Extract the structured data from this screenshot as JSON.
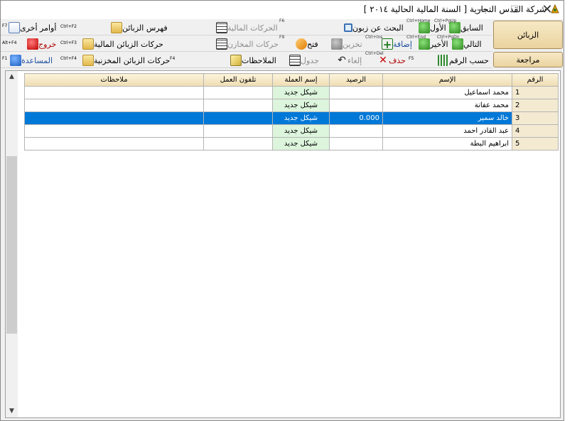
{
  "window": {
    "title": "شركة القدس التجارية  [ السنة المالية الحالية ٢٠١٤ ]",
    "min_label": "—",
    "max_label": "☐",
    "close_label": "✕"
  },
  "toolbar": {
    "row1": [
      {
        "label": "السابق",
        "shortcut": "Ctrl+PgUp",
        "icon": "arrow-up-green-icon"
      },
      {
        "label": "الأول",
        "shortcut": "Ctrl+Home",
        "icon": "double-up-green-icon"
      },
      {
        "label": "البحث عن زبون",
        "shortcut": "",
        "icon": "search-icon"
      },
      {
        "label": "الحركات المالية",
        "shortcut": "F6",
        "icon": "grid-icon"
      },
      {
        "label": "فهرس الزبائن",
        "shortcut": "Ctrl+F2",
        "icon": "folder-icon"
      },
      {
        "label": "أوامر أخرى",
        "shortcut": "F7",
        "icon": "commands-icon"
      }
    ],
    "row2": [
      {
        "label": "التالي",
        "shortcut": "Ctrl+PgDn",
        "icon": "arrow-down-green-icon"
      },
      {
        "label": "الأخير",
        "shortcut": "Ctrl+End",
        "icon": "double-down-green-icon"
      },
      {
        "label": "إضافة",
        "shortcut": "Ctrl+Ins",
        "icon": "add-icon"
      },
      {
        "label": "تخزين",
        "shortcut": "",
        "icon": "save-icon"
      },
      {
        "label": "فتح",
        "shortcut": "",
        "icon": "open-icon"
      },
      {
        "label": "حركات المخازن",
        "shortcut": "F9",
        "icon": "grid-icon"
      },
      {
        "label": "حركات الزبائن المالية",
        "shortcut": "Ctrl+F3",
        "icon": "folder-icon"
      },
      {
        "label": "خروج",
        "shortcut": "Alt+F4",
        "icon": "exit-icon"
      }
    ],
    "row3": [
      {
        "label": "حسب الرقم",
        "shortcut": "F5",
        "icon": "sort-icon"
      },
      {
        "label": "حذف",
        "shortcut": "Ctrl+Del",
        "icon": "delete-icon"
      },
      {
        "label": "إلغاء",
        "shortcut": "",
        "icon": "undo-icon"
      },
      {
        "label": "جدول",
        "shortcut": "",
        "icon": "table-icon"
      },
      {
        "label": "الملاحظات",
        "shortcut": "",
        "icon": "notes-icon"
      },
      {
        "label": "حركات الزبائن المخزنية",
        "shortcut": "F4",
        "icon": "folder-icon"
      },
      {
        "label": "المساعدة",
        "shortcut": "Ctrl+F4",
        "icon": "help-icon"
      },
      {
        "label": "",
        "shortcut": "F1",
        "icon": ""
      }
    ]
  },
  "side": {
    "customers_label": "الزبائن",
    "review_label": "مراجعة"
  },
  "grid": {
    "columns": [
      "الرقم",
      "الإسم",
      "الرصيد",
      "إسم العملة",
      "تلفون العمل",
      "ملاحظات"
    ],
    "rows": [
      {
        "num": "1",
        "name": "محمد اسماعيل",
        "balance": "",
        "currency": "شيكل جديد",
        "phone": "",
        "notes": ""
      },
      {
        "num": "2",
        "name": "محمد عفانة",
        "balance": "",
        "currency": "شيكل جديد",
        "phone": "",
        "notes": ""
      },
      {
        "num": "3",
        "name": "خالد سمير",
        "balance": "0.000",
        "currency": "شيكل جديد",
        "phone": "",
        "notes": ""
      },
      {
        "num": "4",
        "name": "عبد القادر احمد",
        "balance": "",
        "currency": "شيكل جديد",
        "phone": "",
        "notes": ""
      },
      {
        "num": "5",
        "name": "ابراهيم البطة",
        "balance": "",
        "currency": "شيكل جديد",
        "phone": "",
        "notes": ""
      }
    ],
    "selected_row": 3
  },
  "colors": {
    "selection": "#0078d7",
    "header_bg": "#efddb2",
    "currency_bg": "#dcf5dc"
  }
}
